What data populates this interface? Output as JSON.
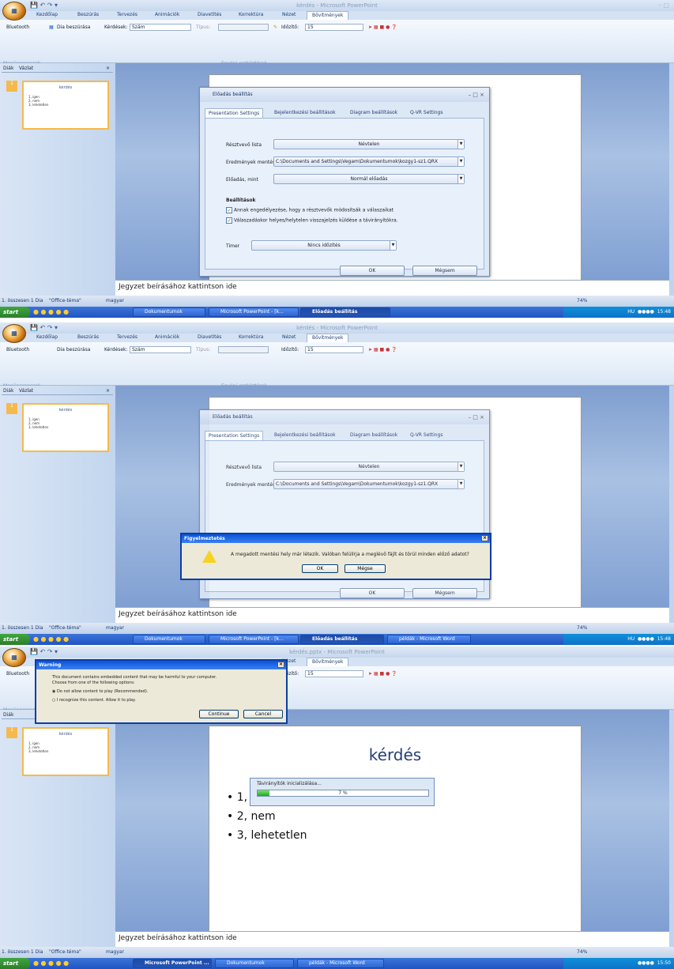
{
  "window_title": "kérdés - Microsoft PowerPoint",
  "window_title_3": "kérdés.pptx - Microsoft PowerPoint",
  "office_button": "Office",
  "tabs": [
    "Kezdőlap",
    "Beszúrás",
    "Tervezés",
    "Animációk",
    "Diavetítés",
    "Korrektúra",
    "Nézet",
    "Bővítmények"
  ],
  "ribbon": {
    "bluetooth": "Bluetooth",
    "insert_slide": "Dia beszúrása",
    "questions_label": "Kérdések:",
    "questions_value": "Szám",
    "type_label": "Típus:",
    "timer_label": "Időzítő:",
    "timer_value": "15",
    "group_menu": "Menüparancsok",
    "group_custom": "Egyéni eszköztárak"
  },
  "pane": {
    "tab_slides": "Diák",
    "tab_outline": "Vázlat",
    "thumb_title": "kérdés",
    "thumb_items": [
      "1, igen",
      "2, nem",
      "3, lehetetlen"
    ],
    "slide_number": "1"
  },
  "notes": "Jegyzet beírásához kattintson ide",
  "status": {
    "slide": "1. összesen 1 Dia",
    "theme": "\"Office-téma\"",
    "lang": "magyar",
    "zoom": "74%"
  },
  "taskbar": {
    "start": "start",
    "items1": [
      "Dokumentumok",
      "Microsoft PowerPoint - [k...",
      "Előadás beállítás"
    ],
    "items2": [
      "Dokumentumok",
      "Microsoft PowerPoint - [k...",
      "Előadás beállítás",
      "példák - Microsoft Word"
    ],
    "items3": [
      "Microsoft PowerPoint ...",
      "Dokumentumok",
      "példák - Microsoft Word"
    ],
    "lang": "HU",
    "time1": "15:48",
    "time2": "15:48",
    "time3": "15:50"
  },
  "settings_dialog": {
    "title": "Előadás beállítás",
    "tabs": [
      "Presentation Settings",
      "Bejelentkezési beállítások",
      "Diagram beállítások",
      "Q-VR Settings"
    ],
    "participant_label": "Résztvevő lista",
    "participant_value": "Névtelen",
    "results_label": "Eredmények mentése",
    "results_value": "C:\\Documents and Settings\\Vegam\\Dokumentumok\\kozgy1-sz1.QRX",
    "presentation_label": "Előadás, mint",
    "presentation_value": "Normál előadás",
    "settings_heading": "Beállítások",
    "check1": "Annak engedélyezése, hogy a résztvevők módosítsák a válaszaikat",
    "check2": "Válaszadáskor helyes/helytelen visszajelzés küldése a távirányítókra.",
    "timer_label": "Timer",
    "timer_value": "Nincs időzítés",
    "ok": "OK",
    "cancel": "Mégsem"
  },
  "warning_hu": {
    "title": "Figyelmeztetés",
    "message": "A megadott mentési hely már létezik. Valóban felülírja a meglévő fájlt és törül minden előző adatot?",
    "ok": "OK",
    "cancel": "Mégse"
  },
  "warning_en": {
    "title": "Warning",
    "line1": "This document contains embedded content that may be harmful to your computer.",
    "line2": "Choose from one of the following options:",
    "opt1": "Do not allow content to play (Recommended).",
    "opt2": "I recognize this content. Allow it to play.",
    "continue": "Continue",
    "cancel": "Cancel"
  },
  "slide3": {
    "title": "kérdés",
    "bullets": [
      "1, igen",
      "2, nem",
      "3, lehetetlen"
    ]
  },
  "progress": {
    "title": "Távirányítók inicializálása...",
    "percent_text": "7 %",
    "value": 0.07
  }
}
